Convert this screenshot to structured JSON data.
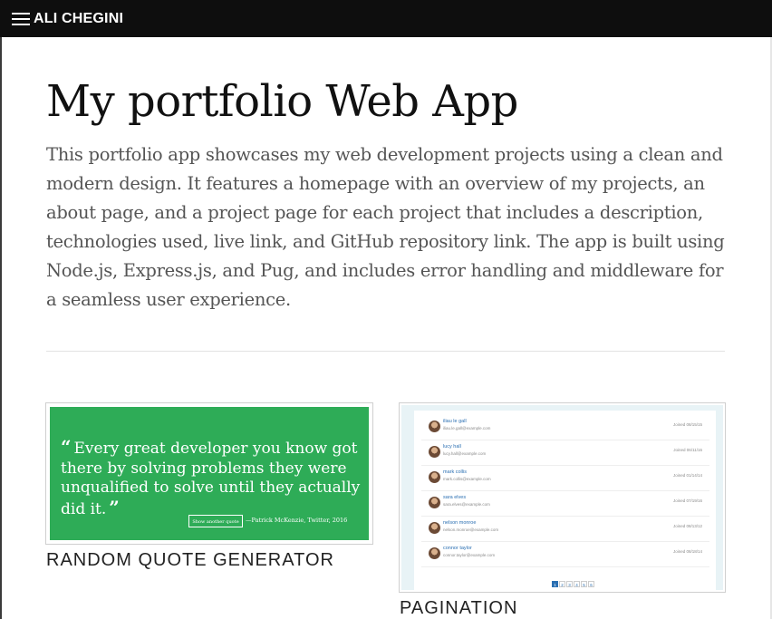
{
  "nav": {
    "brand": "ALI CHEGINI"
  },
  "header": {
    "title": "My portfolio Web App",
    "description": "This portfolio app showcases my web development projects using a clean and modern design. It features a homepage with an overview of my projects, an about page, and a project page for each project that includes a description, technologies used, live link, and GitHub repository link. The app is built using Node.js, Express.js, and Pug, and includes error handling and middleware for a seamless user experience."
  },
  "projects": [
    {
      "caption": "RANDOM QUOTE GENERATOR",
      "thumb": {
        "quote_mark": "“",
        "close_mark": "”",
        "quote": "Every great developer you know got there by solving problems they were unqualified to solve until they actually did it.",
        "button_label": "Show another quote",
        "citation": "—Patrick McKenzie, Twitter, 2016",
        "accent": "#2eac57"
      }
    },
    {
      "caption": "PAGINATION",
      "thumb": {
        "rows": [
          {
            "name": "iliau le gall",
            "email": "iliau.le.gall@example.com",
            "date": "Joined 08/15/15"
          },
          {
            "name": "lucy hall",
            "email": "lucy.hall@example.com",
            "date": "Joined 06/11/16"
          },
          {
            "name": "mark collis",
            "email": "mark.collis@example.com",
            "date": "Joined 01/14/14"
          },
          {
            "name": "sara elves",
            "email": "sara.elves@example.com",
            "date": "Joined 07/19/16"
          },
          {
            "name": "nelson monroe",
            "email": "nelson.monroe@example.com",
            "date": "Joined 08/13/12"
          },
          {
            "name": "connor taylor",
            "email": "connor.taylor@example.com",
            "date": "Joined 08/18/14"
          }
        ],
        "pages": [
          "1",
          "2",
          "3",
          "4",
          "5",
          "6"
        ],
        "active_page": "1",
        "accent": "#2a6fb2"
      }
    }
  ]
}
